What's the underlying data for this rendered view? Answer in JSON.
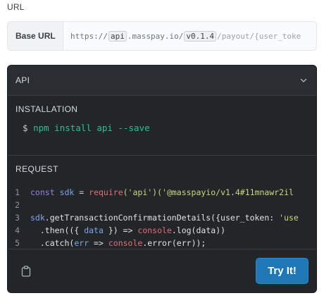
{
  "url_section": {
    "heading": "URL",
    "base_url_label": "Base URL",
    "base_url_parts": {
      "prefix": "https://",
      "chip1": "api",
      "middle": ".masspay.io/",
      "chip2": "v0.1.4",
      "suffix": "/payout/{user_toke"
    }
  },
  "api_panel": {
    "title": "API",
    "installation_label": "INSTALLATION",
    "install_prompt": "$",
    "install_command": "npm install api --save",
    "request_label": "REQUEST",
    "code_lines": [
      {
        "n": "1"
      },
      {
        "n": "2"
      },
      {
        "n": "3"
      },
      {
        "n": "4"
      },
      {
        "n": "5"
      }
    ],
    "code": {
      "l1_const": "const",
      "l1_sdk": "sdk",
      "l1_eq": "=",
      "l1_require": "require",
      "l1_arg": "('api')",
      "l1_str": "('@masspayio/v1.4#11mnawr2il",
      "l3_sdk": "sdk",
      "l3_method": ".getTransactionConfirmationDetails({user_token:",
      "l3_str": "'use",
      "l4_then": ".then(({",
      "l4_data": "data",
      "l4_arrow": "}) =>",
      "l4_console": "console",
      "l4_log": ".log(",
      "l4_data2": "data",
      "l4_close": "))",
      "l5_catch": ".catch(",
      "l5_err": "err",
      "l5_arrow": "=>",
      "l5_console": "console",
      "l5_error": ".error(",
      "l5_err2": "err",
      "l5_close": "));"
    },
    "try_button_label": "Try It!"
  },
  "icons": {
    "chevron": "chevron-down-icon",
    "copy": "clipboard-icon"
  },
  "colors": {
    "panel_bg": "#222629",
    "accent_button": "#1f78b5",
    "install_command": "#2bc28a"
  }
}
